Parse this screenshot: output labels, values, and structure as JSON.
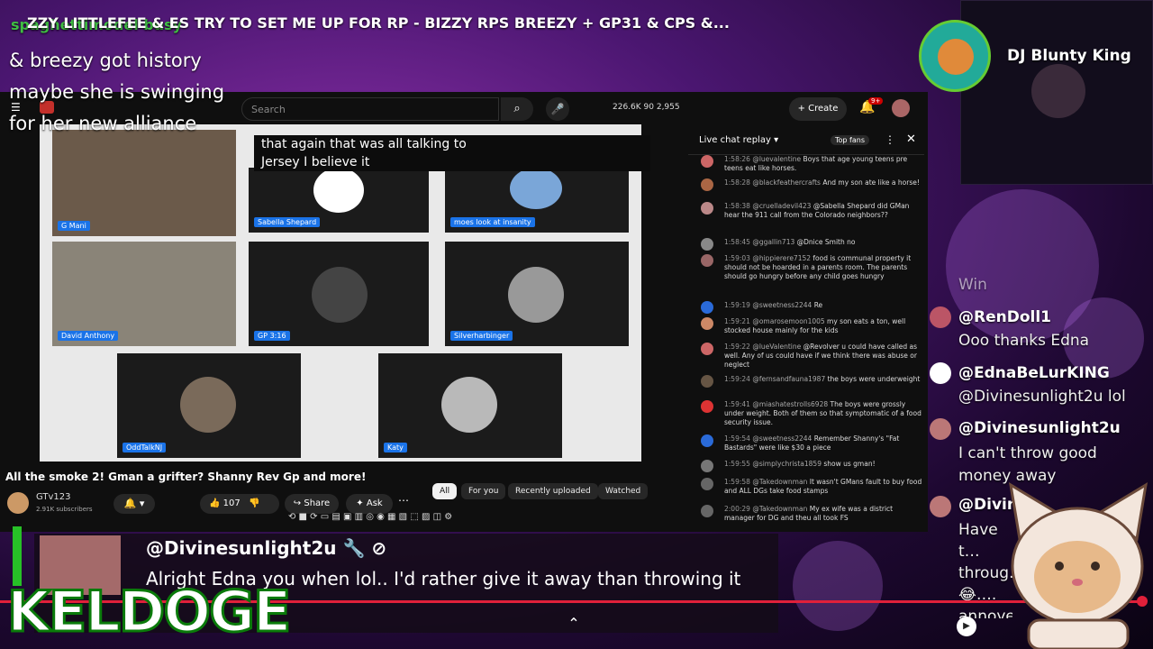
{
  "stream": {
    "title": "ZZY LITTLEFEE & ES TRY TO SET ME UP FOR RP - BIZZY RPS BREEZY + GP31 & CPS &...",
    "spaghetti_overlay": "spaghettimodel busy",
    "overlay_caption_lines": [
      "& breezy got history",
      "maybe she is swinging",
      "for her new alliance"
    ]
  },
  "youtube": {
    "search_placeholder": "Search",
    "search_icon": "search-icon",
    "stats": "226.6K   90   2,955",
    "create_label": "Create",
    "bell_badge": "9+",
    "video_caption_lines": [
      "that again that was all talking to",
      "Jersey I believe it"
    ],
    "tiles": [
      {
        "label": "G Mani"
      },
      {
        "label": "Sabella Shepard"
      },
      {
        "label": "moes look at insanity"
      },
      {
        "label": "David Anthony"
      },
      {
        "label": "GP 3:16"
      },
      {
        "label": "Silverharbinger"
      },
      {
        "label": "OddTalkNJ"
      },
      {
        "label": "Katy"
      }
    ],
    "video_title": "All the smoke 2! Gman a grifter? Shanny Rev Gp and more!",
    "channel_name": "GTv123",
    "channel_subs": "2.91K subscribers",
    "like_count": "107",
    "share_label": "Share",
    "ask_label": "Ask",
    "chips": [
      "All",
      "For you",
      "Recently uploaded",
      "Watched"
    ]
  },
  "live_chat": {
    "title": "Live chat replay",
    "top_fans": "Top fans",
    "messages": [
      {
        "time": "1:58:26",
        "author": "@luevalentine",
        "text": "Boys that age young teens pre teens eat like horses."
      },
      {
        "time": "1:58:28",
        "author": "@blackfeathercrafts",
        "text": "And my son ate like a horse!"
      },
      {
        "time": "1:58:38",
        "author": "@cruelladevil423",
        "text": "@Sabella Shepard did GMan hear the 911 call from the Colorado neighbors??"
      },
      {
        "time": "1:58:45",
        "author": "@ggallin713",
        "text": "@Dnice Smith no"
      },
      {
        "time": "1:59:03",
        "author": "@hippierere7152",
        "text": "food is communal property it should not be hoarded in a parents room. The parents should go hungry before any child goes hungry"
      },
      {
        "time": "1:59:19",
        "author": "@sweetness2244",
        "text": "Re"
      },
      {
        "time": "1:59:21",
        "author": "@omarosemoon1005",
        "text": "my son eats a ton, well stocked house mainly for the kids"
      },
      {
        "time": "1:59:22",
        "author": "@lueValentine",
        "text": "@Revolver u could have called as well. Any of us could have if we think there was abuse or neglect"
      },
      {
        "time": "1:59:24",
        "author": "@fernsandfauna1987",
        "text": "the boys were underweight"
      },
      {
        "time": "1:59:41",
        "author": "@miashatestrolls6928",
        "text": "The boys were grossly under weight. Both of them so that symptomatic of a food security issue."
      },
      {
        "time": "1:59:54",
        "author": "@sweetness2244",
        "text": "Remember Shanny's \"Fat Bastards\" were like $30 a piece"
      },
      {
        "time": "1:59:55",
        "author": "@simplychrista1859",
        "text": "show us gman!"
      },
      {
        "time": "1:59:58",
        "author": "@Takedownman",
        "text": "It wasn't GMans fault to buy food and ALL DGs take food stamps"
      },
      {
        "time": "2:00:29",
        "author": "@Takedownman",
        "text": "My ex wife was a district manager for DG and theu all took FS"
      }
    ]
  },
  "streamer": {
    "name": "DJ Blunty King"
  },
  "stream_chat": [
    {
      "user": "",
      "text": "Win"
    },
    {
      "user": "@RenDoll1",
      "text": "Ooo thanks Edna"
    },
    {
      "user": "@EdnaBeLurKING",
      "text": "@Divinesunlight2u lol"
    },
    {
      "user": "@Divinesunlight2u",
      "text": "I can't throw good money away"
    },
    {
      "user": "@Divin",
      "text": "Have t… throug… 😂…. annoyed… waste"
    }
  ],
  "featured": {
    "user": "@Divinesunlight2u 🔧 ⊘",
    "message": "Alright Edna you when lol.. I'd rather give it away than throwing it"
  },
  "logo": {
    "text": "KELDOGE"
  },
  "colors": {
    "accent_red": "#e0203a",
    "keldoge_green": "#27c027",
    "bg_purple": "#4a1670"
  }
}
